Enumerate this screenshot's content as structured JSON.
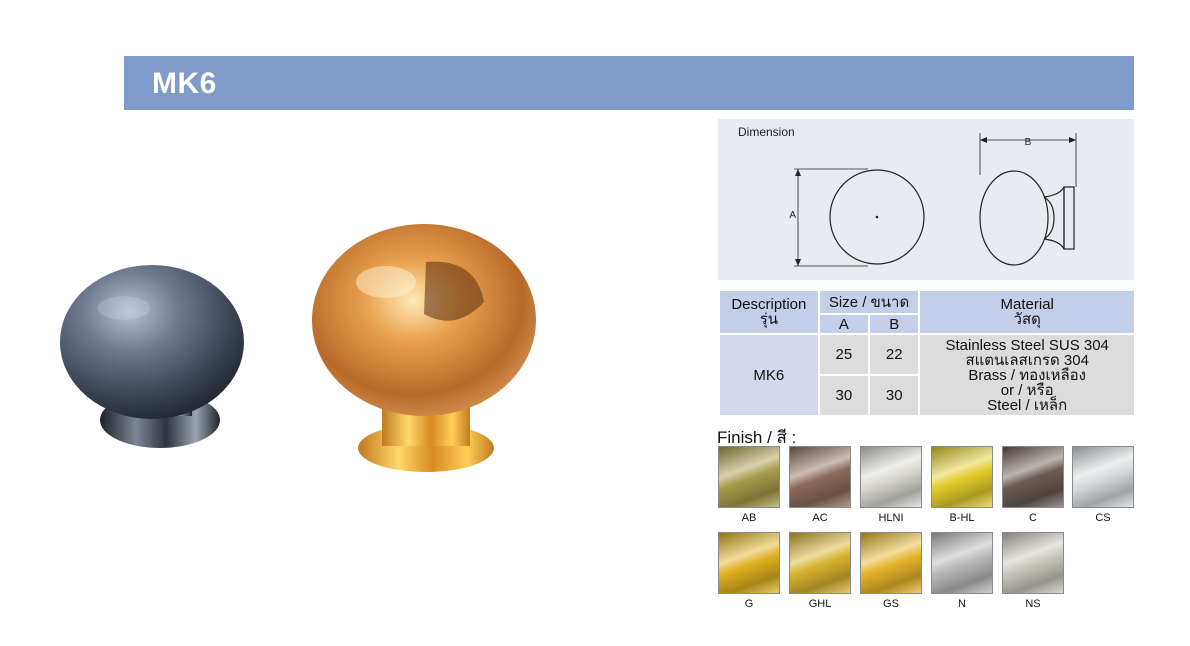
{
  "header": {
    "title": "MK6"
  },
  "dimension": {
    "label": "Dimension",
    "mark_a": "A",
    "mark_b": "B"
  },
  "table": {
    "col_description": "Description",
    "col_description_thai": "รุ่น",
    "col_size": "Size / ขนาด",
    "col_a": "A",
    "col_b": "B",
    "col_material": "Material",
    "col_material_thai": "วัสดุ",
    "model": "MK6",
    "rows": [
      {
        "a": "25",
        "b": "22"
      },
      {
        "a": "30",
        "b": "30"
      }
    ],
    "material_lines": [
      "Stainless Steel SUS 304",
      "สแตนเลสเกรด 304",
      "Brass / ทองเหลือง",
      "or / หรือ",
      "Steel / เหล็ก"
    ]
  },
  "finish": {
    "title": "Finish / สี :",
    "items": [
      {
        "code": "AB",
        "color": "#a89a4a"
      },
      {
        "code": "AC",
        "color": "#8a6a5a"
      },
      {
        "code": "HLNI",
        "color": "#d8d8d0"
      },
      {
        "code": "B-HL",
        "color": "#e2cc2a"
      },
      {
        "code": "C",
        "color": "#6a5a52"
      },
      {
        "code": "CS",
        "color": "#d6dadc"
      },
      {
        "code": "G",
        "color": "#e0b020"
      },
      {
        "code": "GHL",
        "color": "#d8b22e"
      },
      {
        "code": "GS",
        "color": "#e6b42a"
      },
      {
        "code": "N",
        "color": "#b8b8b8"
      },
      {
        "code": "NS",
        "color": "#c8c6bc"
      }
    ]
  }
}
